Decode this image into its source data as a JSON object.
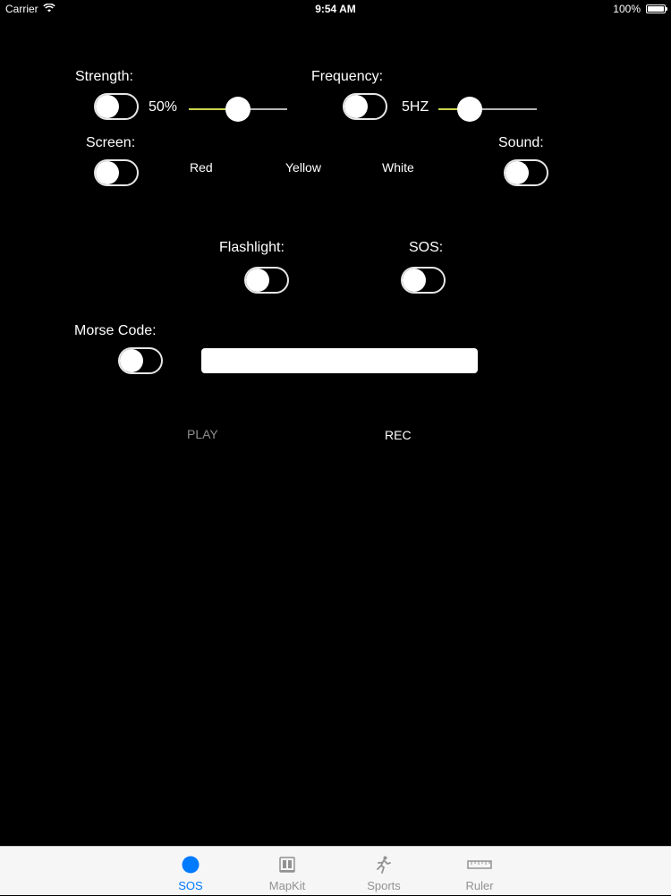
{
  "status_bar": {
    "carrier": "Carrier",
    "time": "9:54 AM",
    "battery": "100%"
  },
  "controls": {
    "strength_label": "Strength:",
    "strength_value": "50%",
    "strength_level": 0.5,
    "frequency_label": "Frequency:",
    "frequency_value": "5HZ",
    "frequency_level": 0.25,
    "screen_label": "Screen:",
    "color_red": "Red",
    "color_yellow": "Yellow",
    "color_white": "White",
    "sound_label": "Sound:",
    "flashlight_label": "Flashlight:",
    "sos_label": "SOS:",
    "morse_label": "Morse Code:",
    "morse_value": "",
    "play_label": "PLAY",
    "rec_label": "REC"
  },
  "tabs": [
    {
      "label": "SOS",
      "icon": "circle-icon",
      "active": true
    },
    {
      "label": "MapKit",
      "icon": "map-icon",
      "active": false
    },
    {
      "label": "Sports",
      "icon": "runner-icon",
      "active": false
    },
    {
      "label": "Ruler",
      "icon": "ruler-icon",
      "active": false
    }
  ],
  "colors": {
    "background": "#000000",
    "accent": "#007aff",
    "slider_min_track": "#c8d24a",
    "tab_inactive": "#929292",
    "play_disabled": "#8e8e8e"
  }
}
